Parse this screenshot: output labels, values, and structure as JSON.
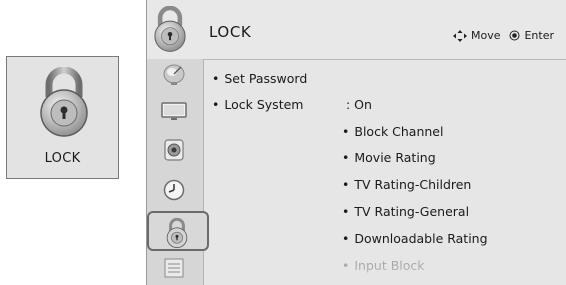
{
  "category_tile": {
    "label": "LOCK",
    "icon": "padlock-icon"
  },
  "header": {
    "title": "LOCK",
    "icon": "padlock-icon",
    "hints": [
      {
        "icon": "move-arrows-icon",
        "label": "Move"
      },
      {
        "icon": "enter-circle-icon",
        "label": "Enter"
      }
    ]
  },
  "sidebar": {
    "items": [
      {
        "name": "satellite-dish-icon",
        "selected": false
      },
      {
        "name": "tv-screen-icon",
        "selected": false
      },
      {
        "name": "speaker-icon",
        "selected": false
      },
      {
        "name": "clock-icon",
        "selected": false
      },
      {
        "name": "padlock-icon",
        "selected": true
      },
      {
        "name": "options-icon",
        "selected": false
      }
    ]
  },
  "menu": {
    "bullet": "•",
    "set_password": "Set Password",
    "lock_system": {
      "label": "Lock System",
      "value": ": On"
    },
    "options": [
      "Block Channel",
      "Movie Rating",
      "TV Rating-Children",
      "TV Rating-General",
      "Downloadable Rating",
      "Input Block"
    ]
  },
  "colors": {
    "background": "#e6e6e6",
    "sidebar": "#d6d6d6",
    "text": "#1a1a1a",
    "faded_text": "#a9a9a9"
  }
}
